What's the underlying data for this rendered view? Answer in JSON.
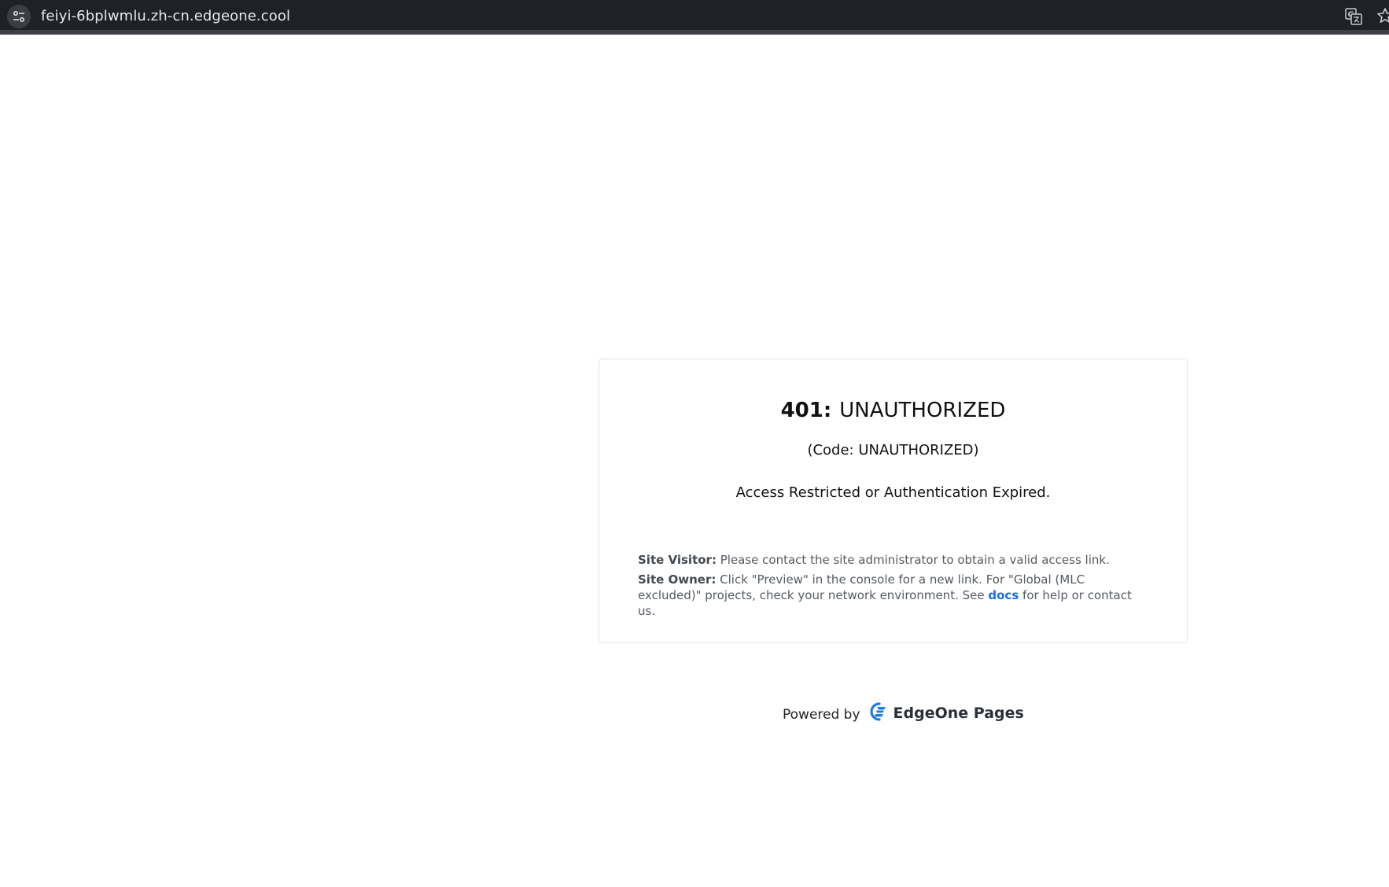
{
  "browser": {
    "url": "feiyi-6bplwmlu.zh-cn.edgeone.cool",
    "site_info_icon": "site-settings-icon",
    "translate_icon": "translate-icon",
    "bookmark_icon": "star-icon"
  },
  "error": {
    "status_code": "401:",
    "status_text": "UNAUTHORIZED",
    "code_line": "(Code: UNAUTHORIZED)",
    "message": "Access Restricted or Authentication Expired.",
    "visitor_label": "Site Visitor:",
    "visitor_text": " Please contact the site administrator to obtain a valid access link.",
    "owner_label": "Site Owner:",
    "owner_text_1": " Click \"Preview\" in the console for a new link. For \"Global (MLC excluded)\" projects, check your network environment. See ",
    "docs_link": "docs",
    "owner_text_2": " for help or contact us."
  },
  "footer": {
    "powered_by": "Powered by",
    "brand": "EdgeOne Pages",
    "brand_icon": "edgeone-logo-icon"
  },
  "colors": {
    "browser_bar": "#1f2126",
    "link": "#1a6fe0",
    "logo_blue": "#1e7ce8"
  }
}
